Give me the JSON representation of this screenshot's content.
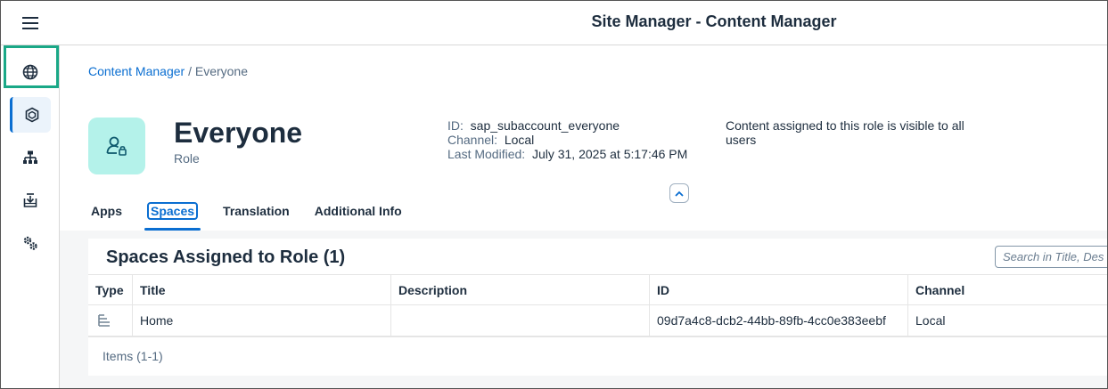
{
  "shell": {
    "title": "Site Manager - Content Manager",
    "menu_icon": "hamburger-menu-icon"
  },
  "sidenav": {
    "items": [
      {
        "icon": "globe-icon",
        "selected": false,
        "highlighted": true
      },
      {
        "icon": "content-package-icon",
        "selected": true
      },
      {
        "icon": "hierarchy-icon",
        "selected": false
      },
      {
        "icon": "download-tray-icon",
        "selected": false
      },
      {
        "icon": "settings-gears-icon",
        "selected": false
      }
    ]
  },
  "breadcrumb": {
    "link": "Content Manager",
    "separator": " / ",
    "current": "Everyone"
  },
  "object": {
    "title": "Everyone",
    "subtitle": "Role",
    "avatar_icon": "user-role-icon",
    "attributes": [
      {
        "label": "ID:",
        "value": "sap_subaccount_everyone"
      },
      {
        "label": "Channel:",
        "value": "Local"
      },
      {
        "label": "Last Modified:",
        "value": "July 31, 2025 at 5:17:46 PM"
      }
    ],
    "description": "Content assigned to this role is visible to all users"
  },
  "tabs": [
    {
      "label": "Apps",
      "active": false
    },
    {
      "label": "Spaces",
      "active": true
    },
    {
      "label": "Translation",
      "active": false
    },
    {
      "label": "Additional Info",
      "active": false
    }
  ],
  "table": {
    "title": "Spaces Assigned to Role (1)",
    "search_placeholder": "Search in Title, Des",
    "columns": [
      "Type",
      "Title",
      "Description",
      "ID",
      "Channel"
    ],
    "rows": [
      {
        "type_icon": "space-icon",
        "title": "Home",
        "description": "",
        "id": "09d7a4c8-dcb2-44bb-89fb-4cc0e383eebf",
        "channel": "Local"
      }
    ],
    "items_count": "Items (1-1)"
  },
  "colors": {
    "accent": "#0a6ed1",
    "highlight": "#1aa887",
    "avatar_bg": "#b4f2ea"
  }
}
